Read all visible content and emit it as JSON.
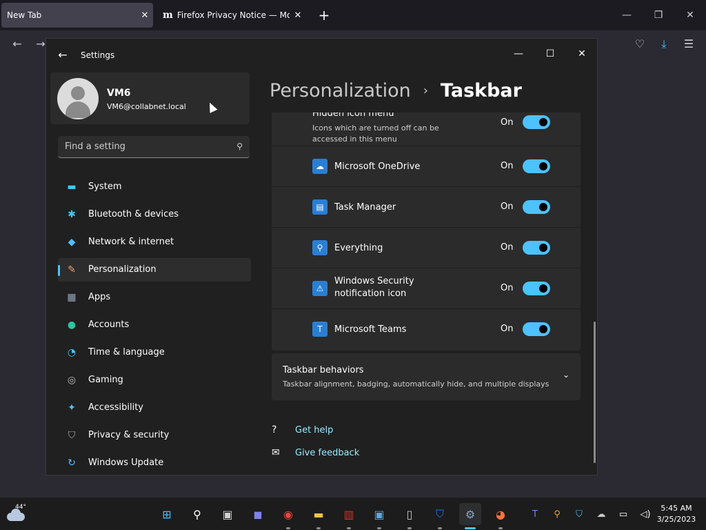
{
  "browser": {
    "tabs": [
      {
        "title": "New Tab",
        "close": "✕"
      },
      {
        "favicon": "m",
        "title": "Firefox Privacy Notice — Mozill",
        "close": "✕"
      }
    ],
    "new_tab": "+",
    "window_controls": {
      "minimize": "—",
      "restore": "❐",
      "close": "✕"
    },
    "nav": {
      "back": "←",
      "forward": "→",
      "pocket": "♡",
      "download": "⤓",
      "menu": "☰"
    }
  },
  "settings": {
    "window_title": "Settings",
    "back": "←",
    "controls": {
      "minimize": "—",
      "maximize": "☐",
      "close": "✕"
    },
    "profile": {
      "name": "VM6",
      "email": "VM6@collabnet.local"
    },
    "search": {
      "placeholder": "Find a setting",
      "icon": "⚲"
    },
    "nav": [
      {
        "label": "System",
        "icon": "monitor-icon",
        "glyph": "▬",
        "color": "#4cc2ff"
      },
      {
        "label": "Bluetooth & devices",
        "icon": "bluetooth-icon",
        "glyph": "✱",
        "color": "#4cc2ff"
      },
      {
        "label": "Network & internet",
        "icon": "wifi-icon",
        "glyph": "◆",
        "color": "#4cc2ff"
      },
      {
        "label": "Personalization",
        "icon": "brush-icon",
        "glyph": "✎",
        "color": "#f0a070"
      },
      {
        "label": "Apps",
        "icon": "apps-icon",
        "glyph": "▦",
        "color": "#9aa8c0"
      },
      {
        "label": "Accounts",
        "icon": "accounts-icon",
        "glyph": "●",
        "color": "#2ec4a0"
      },
      {
        "label": "Time & language",
        "icon": "globe-clock-icon",
        "glyph": "◔",
        "color": "#4cc2ff"
      },
      {
        "label": "Gaming",
        "icon": "gamepad-icon",
        "glyph": "◎",
        "color": "#c0c0c0"
      },
      {
        "label": "Accessibility",
        "icon": "accessibility-icon",
        "glyph": "✦",
        "color": "#4cc2ff"
      },
      {
        "label": "Privacy & security",
        "icon": "shield-icon",
        "glyph": "⛉",
        "color": "#b0b0b0"
      },
      {
        "label": "Windows Update",
        "icon": "update-icon",
        "glyph": "↻",
        "color": "#4cc2ff"
      }
    ],
    "selected_nav": "Personalization",
    "breadcrumb": {
      "parent": "Personalization",
      "separator": "›",
      "current": "Taskbar"
    },
    "hidden_icon_menu": {
      "title": "Hidden icon menu",
      "description": "Icons which are turned off can be accessed in this menu",
      "state": "On",
      "on": true
    },
    "tray_apps": [
      {
        "name": "Microsoft OneDrive",
        "icon": "onedrive-icon",
        "glyph": "☁",
        "color": "#2a7fd4",
        "state": "On",
        "on": true
      },
      {
        "name": "Task Manager",
        "icon": "task-manager-icon",
        "glyph": "▤",
        "color": "#2a7fd4",
        "state": "On",
        "on": true
      },
      {
        "name": "Everything",
        "icon": "everything-icon",
        "glyph": "⚲",
        "color": "#2a7fd4",
        "state": "On",
        "on": true
      },
      {
        "name": "Windows Security notification icon",
        "icon": "windows-security-icon",
        "glyph": "⚠",
        "color": "#2a7fd4",
        "state": "On",
        "on": true
      },
      {
        "name": "Microsoft Teams",
        "icon": "teams-icon",
        "glyph": "T",
        "color": "#2a7fd4",
        "state": "On",
        "on": true
      }
    ],
    "behaviors": {
      "title": "Taskbar behaviors",
      "description": "Taskbar alignment, badging, automatically hide, and multiple displays",
      "chevron": "⌄"
    },
    "links": [
      {
        "label": "Get help",
        "icon": "help-icon",
        "glyph": "?"
      },
      {
        "label": "Give feedback",
        "icon": "feedback-icon",
        "glyph": "✉"
      }
    ]
  },
  "taskbar": {
    "weather_temp": "44°",
    "apps": [
      {
        "name": "start-icon",
        "glyph": "⊞",
        "color": "#4cc2ff",
        "running": false
      },
      {
        "name": "search-icon",
        "glyph": "⚲",
        "color": "#ffffff",
        "running": false
      },
      {
        "name": "task-view-icon",
        "glyph": "▣",
        "color": "#d0d0d0",
        "running": false
      },
      {
        "name": "chat-icon",
        "glyph": "◼",
        "color": "#7b83eb",
        "running": false
      },
      {
        "name": "chrome-icon",
        "glyph": "◉",
        "color": "#e8453c",
        "running": true
      },
      {
        "name": "file-explorer-icon",
        "glyph": "▬",
        "color": "#f4c542",
        "running": true
      },
      {
        "name": "toolbox-icon",
        "glyph": "▥",
        "color": "#d0342c",
        "running": true
      },
      {
        "name": "remote-desktop-icon",
        "glyph": "▣",
        "color": "#5aa8e0",
        "running": true
      },
      {
        "name": "notepad-icon",
        "glyph": "▯",
        "color": "#c8c8c8",
        "running": true
      },
      {
        "name": "defender-icon",
        "glyph": "⛉",
        "color": "#1a73e8",
        "running": true
      },
      {
        "name": "settings-icon",
        "glyph": "⚙",
        "color": "#8aa4c8",
        "running": true,
        "active": true
      },
      {
        "name": "firefox-icon",
        "glyph": "◕",
        "color": "#ff7139",
        "running": true
      }
    ],
    "tray": [
      {
        "name": "teams-tray-icon",
        "glyph": "T",
        "color": "#7b83eb"
      },
      {
        "name": "everything-tray-icon",
        "glyph": "⚲",
        "color": "#ff9a1a"
      },
      {
        "name": "security-tray-icon",
        "glyph": "⛉",
        "color": "#4cc2ff"
      },
      {
        "name": "onedrive-tray-icon",
        "glyph": "☁",
        "color": "#c8c8c8"
      },
      {
        "name": "network-tray-icon",
        "glyph": "▭",
        "color": "#ffffff"
      },
      {
        "name": "volume-tray-icon",
        "glyph": "◁)",
        "color": "#ffffff"
      }
    ],
    "clock": {
      "time": "5:45 AM",
      "date": "3/25/2023"
    }
  }
}
